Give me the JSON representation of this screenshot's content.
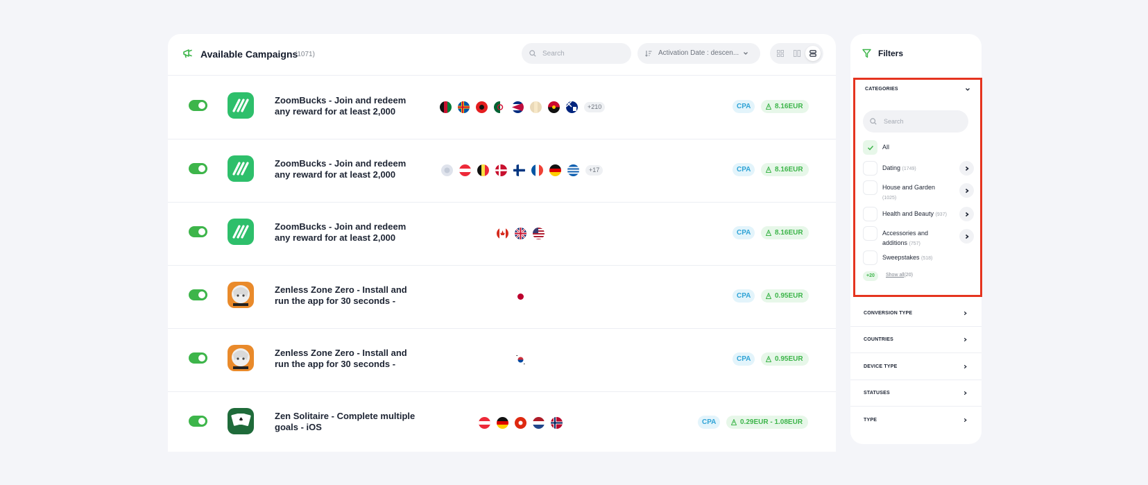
{
  "header": {
    "title": "Available Campaigns",
    "count": "(1071)",
    "search_placeholder": "Search",
    "sort_label": "Activation Date : descen..."
  },
  "campaigns": [
    {
      "title": "ZoomBucks - Join and redeem any reward for at least 2,000",
      "more_countries": "+210",
      "type": "CPA",
      "payout": "8.16EUR",
      "logo": "zoombucks-logo"
    },
    {
      "title": "ZoomBucks - Join and redeem any reward for at least 2,000",
      "more_countries": "+17",
      "type": "CPA",
      "payout": "8.16EUR",
      "logo": "zoombucks-logo"
    },
    {
      "title": "ZoomBucks - Join and redeem any reward for at least 2,000",
      "more_countries": "",
      "type": "CPA",
      "payout": "8.16EUR",
      "logo": "zoombucks-logo"
    },
    {
      "title": "Zenless Zone Zero - Install and run the app for 30 seconds -",
      "more_countries": "",
      "type": "CPA",
      "payout": "0.95EUR",
      "logo": "zenless-zone-zero-logo"
    },
    {
      "title": "Zenless Zone Zero - Install and run the app for 30 seconds -",
      "more_countries": "",
      "type": "CPA",
      "payout": "0.95EUR",
      "logo": "zenless-zone-zero-logo"
    },
    {
      "title": "Zen Solitaire - Complete multiple goals - iOS",
      "more_countries": "",
      "type": "CPA",
      "payout": "0.29EUR - 1.08EUR",
      "logo": "zen-solitaire-logo"
    }
  ],
  "filters": {
    "title": "Filters",
    "categories": {
      "header": "CATEGORIES",
      "search_placeholder": "Search",
      "items": [
        {
          "label": "All",
          "count": "",
          "checked": true
        },
        {
          "label": "Dating",
          "count": "(1749)"
        },
        {
          "label": "House and Garden",
          "count": "(1025)"
        },
        {
          "label": "Health and Beauty",
          "count": "(937)"
        },
        {
          "label": "Accessories and additions",
          "count": "(757)"
        },
        {
          "label": "Sweepstakes",
          "count": "(518)"
        }
      ],
      "more_badge": "+20",
      "show_all_link": "Show all",
      "show_all_count": "(20)"
    },
    "sections": [
      "CONVERSION TYPE",
      "COUNTRIES",
      "DEVICE TYPE",
      "STATUSES",
      "TYPE"
    ]
  },
  "colors": {
    "accent_green": "#3db54a",
    "cpa_blue": "#2fa3d6",
    "highlight_red": "#e5341f"
  }
}
